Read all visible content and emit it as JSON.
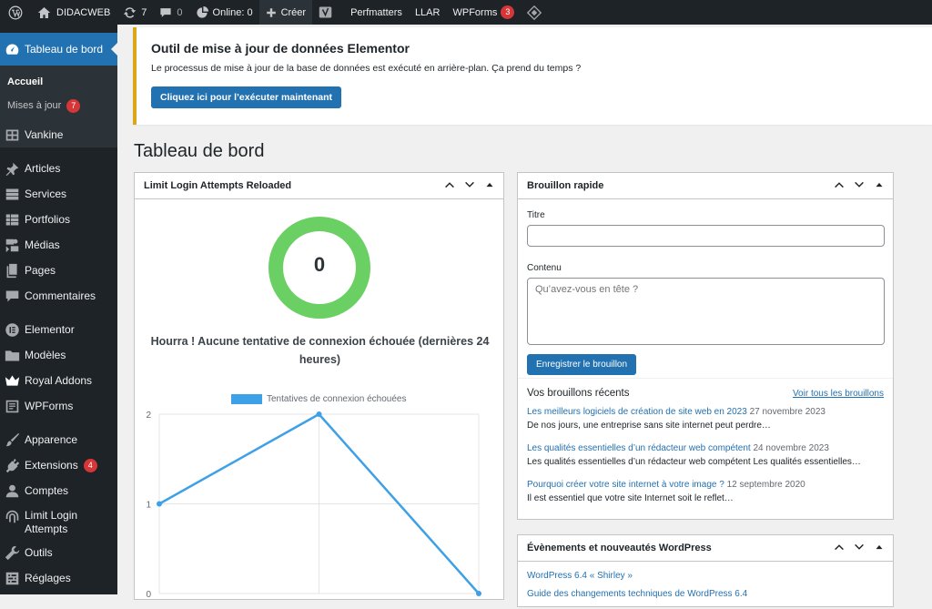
{
  "adminbar": {
    "site": "DIDACWEB",
    "updates": "7",
    "comments": "0",
    "online": "Online: 0",
    "create": "Créer",
    "perfmatters": "Perfmatters",
    "llar": "LLAR",
    "wpforms": "WPForms",
    "wpforms_count": "3"
  },
  "sidebar": {
    "dashboard": "Tableau de bord",
    "sub": [
      {
        "label": "Accueil"
      },
      {
        "label": "Mises à jour",
        "badge": "7"
      }
    ],
    "items": [
      {
        "label": "Vankine",
        "icon": "vankine-icon"
      },
      {
        "label": "Articles",
        "icon": "pin-icon"
      },
      {
        "label": "Services",
        "icon": "services-icon"
      },
      {
        "label": "Portfolios",
        "icon": "portfolio-icon"
      },
      {
        "label": "Médias",
        "icon": "media-icon"
      },
      {
        "label": "Pages",
        "icon": "pages-icon"
      },
      {
        "label": "Commentaires",
        "icon": "comment-icon"
      },
      {
        "label": "Elementor",
        "icon": "elementor-icon"
      },
      {
        "label": "Modèles",
        "icon": "folder-icon"
      },
      {
        "label": "Royal Addons",
        "icon": "crown-icon"
      },
      {
        "label": "WPForms",
        "icon": "form-icon"
      },
      {
        "label": "Apparence",
        "icon": "brush-icon"
      },
      {
        "label": "Extensions",
        "icon": "plug-icon",
        "badge": "4"
      },
      {
        "label": "Comptes",
        "icon": "user-icon"
      },
      {
        "label": "Limit Login Attempts",
        "icon": "fingerprint-icon"
      },
      {
        "label": "Outils",
        "icon": "wrench-icon"
      },
      {
        "label": "Réglages",
        "icon": "settings-icon"
      }
    ]
  },
  "notice": {
    "title": "Outil de mise à jour de données Elementor",
    "text": "Le processus de mise à jour de la base de données est exécuté en arrière-plan. Ça prend du temps ?",
    "button": "Cliquez ici pour l’exécuter maintenant"
  },
  "page_title": "Tableau de bord",
  "llar": {
    "title": "Limit Login Attempts Reloaded",
    "count": "0",
    "message": "Hourra ! Aucune tentative de connexion échouée (dernières 24 heures)",
    "legend": "Tentatives de connexion échouées"
  },
  "chart_data": {
    "type": "line",
    "series": [
      {
        "name": "Tentatives de connexion échouées",
        "values": [
          1,
          2,
          0
        ]
      }
    ],
    "ylim": [
      0,
      2
    ],
    "yticks": [
      "2",
      "1",
      "0"
    ],
    "color": "#3ea0e6"
  },
  "quickdraft": {
    "title": "Brouillon rapide",
    "label_title": "Titre",
    "label_content": "Contenu",
    "placeholder": "Qu’avez-vous en tête ?",
    "button": "Enregistrer le brouillon",
    "recent_title": "Vos brouillons récents",
    "view_all": "Voir tous les brouillons",
    "drafts": [
      {
        "title": "Les meilleurs logiciels de création de site web en 2023",
        "date": "27 novembre 2023",
        "excerpt": "De nos jours, une entreprise sans site internet peut perdre…"
      },
      {
        "title": "Les qualités essentielles d’un rédacteur web compétent",
        "date": "24 novembre 2023",
        "excerpt": "Les qualités essentielles d’un rédacteur web compétent Les qualités essentielles…"
      },
      {
        "title": "Pourquoi créer votre site internet à votre image ?",
        "date": "12 septembre 2020",
        "excerpt": "Il est essentiel que votre site Internet soit le reflet…"
      }
    ]
  },
  "events": {
    "title": "Évènements et nouveautés WordPress",
    "link1": "WordPress 6.4 « Shirley »",
    "link2": "Guide des changements techniques de WordPress 6.4"
  }
}
